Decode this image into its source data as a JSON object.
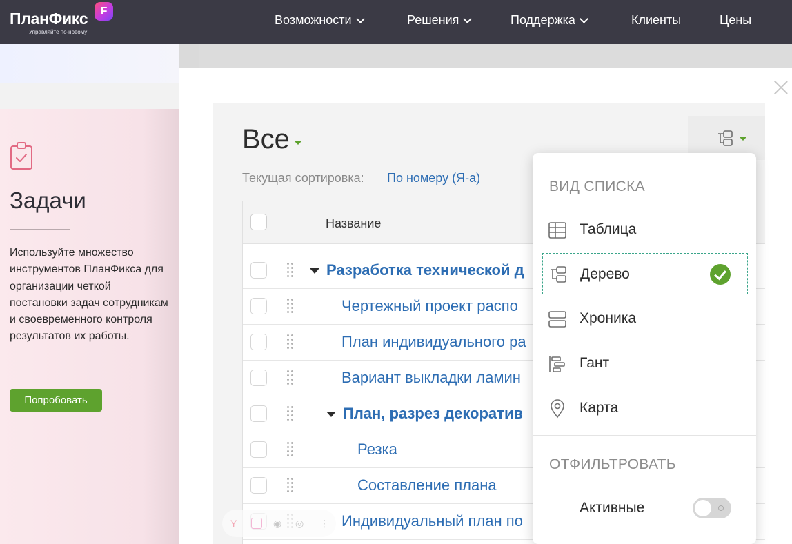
{
  "header": {
    "logo": "ПланФикс",
    "logo_badge": "F",
    "logo_tagline": "Управляйте по-новому",
    "nav": [
      {
        "label": "Возможности",
        "dropdown": true
      },
      {
        "label": "Решения",
        "dropdown": true
      },
      {
        "label": "Поддержка",
        "dropdown": true
      },
      {
        "label": "Клиенты",
        "dropdown": false
      },
      {
        "label": "Цены",
        "dropdown": false
      }
    ]
  },
  "promo": {
    "title": "Задачи",
    "description": "Используйте множество инструментов ПланФикса для организации четкой постановки задач сотрудникам и своевременного контроля результатов их работы.",
    "button": "Попробовать"
  },
  "tasks": {
    "filter_title": "Все",
    "sort_label": "Текущая сортировка:",
    "sort_value": "По номеру (Я-а)",
    "column_name": "Название",
    "rows": [
      {
        "title": "Разработка технической д",
        "level": 0,
        "expanded": true,
        "bold": true
      },
      {
        "title": "Чертежный проект распо",
        "level": 1,
        "expanded": false,
        "bold": false
      },
      {
        "title": "План индивидуального ра",
        "level": 1,
        "expanded": false,
        "bold": false
      },
      {
        "title": "Вариант выкладки ламин",
        "level": 1,
        "expanded": false,
        "bold": false
      },
      {
        "title": "План, разрез декоратив",
        "level": 1,
        "expanded": true,
        "bold": true
      },
      {
        "title": "Резка",
        "level": 2,
        "expanded": false,
        "bold": false
      },
      {
        "title": "Составление плана",
        "level": 2,
        "expanded": false,
        "bold": false
      },
      {
        "title": "Индивидуальный план по",
        "level": 1,
        "expanded": false,
        "bold": false
      }
    ]
  },
  "view_menu": {
    "section_view": "ВИД СПИСКА",
    "items": [
      {
        "label": "Таблица",
        "icon": "table-icon"
      },
      {
        "label": "Дерево",
        "icon": "tree-icon",
        "selected": true
      },
      {
        "label": "Хроника",
        "icon": "chronicle-icon"
      },
      {
        "label": "Гант",
        "icon": "gantt-icon"
      },
      {
        "label": "Карта",
        "icon": "map-pin-icon"
      }
    ],
    "section_filter": "ОТФИЛЬТРОВАТЬ",
    "filter_active_label": "Активные",
    "filter_active_on": false
  },
  "colors": {
    "nav_bg": "#3b3a45",
    "accent_green": "#5ea22e",
    "link_blue": "#2d6db3",
    "selection_border": "#3aa58a"
  }
}
